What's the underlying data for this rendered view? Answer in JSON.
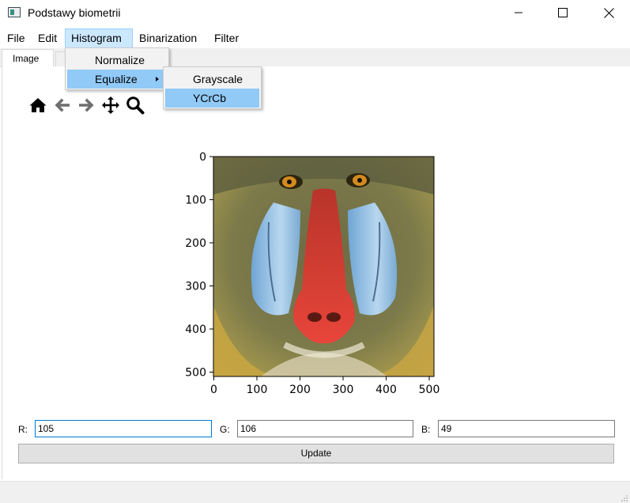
{
  "window": {
    "title": "Podstawy biometrii",
    "icon": "app-window-icon"
  },
  "menubar": {
    "items": [
      {
        "label": "File"
      },
      {
        "label": "Edit"
      },
      {
        "label": "Histogram",
        "active": true
      },
      {
        "label": "Binarization"
      },
      {
        "label": "Filter"
      }
    ]
  },
  "histogram_menu": {
    "items": [
      {
        "label": "Normalize"
      },
      {
        "label": "Equalize",
        "has_submenu": true,
        "highlighted": true
      }
    ]
  },
  "equalize_submenu": {
    "items": [
      {
        "label": "Grayscale"
      },
      {
        "label": "YCrCb",
        "highlighted": true
      }
    ]
  },
  "tabs": [
    {
      "label": "Image",
      "selected": true
    },
    {
      "label": ""
    }
  ],
  "toolbar": {
    "icons": [
      "home-icon",
      "back-arrow-icon",
      "forward-arrow-icon",
      "pan-icon",
      "zoom-icon"
    ]
  },
  "plot": {
    "image": "mandrill-photo",
    "x_ticks": [
      "0",
      "100",
      "200",
      "300",
      "400",
      "500"
    ],
    "y_ticks": [
      "0",
      "100",
      "200",
      "300",
      "400",
      "500"
    ]
  },
  "form": {
    "r_label": "R:",
    "g_label": "G:",
    "b_label": "B:",
    "r_value": "105",
    "g_value": "106",
    "b_value": "49",
    "update_label": "Update"
  },
  "colors": {
    "menu_highlight": "#91c9f7",
    "menubar_active": "#cce8ff",
    "focus_border": "#0078d7"
  }
}
